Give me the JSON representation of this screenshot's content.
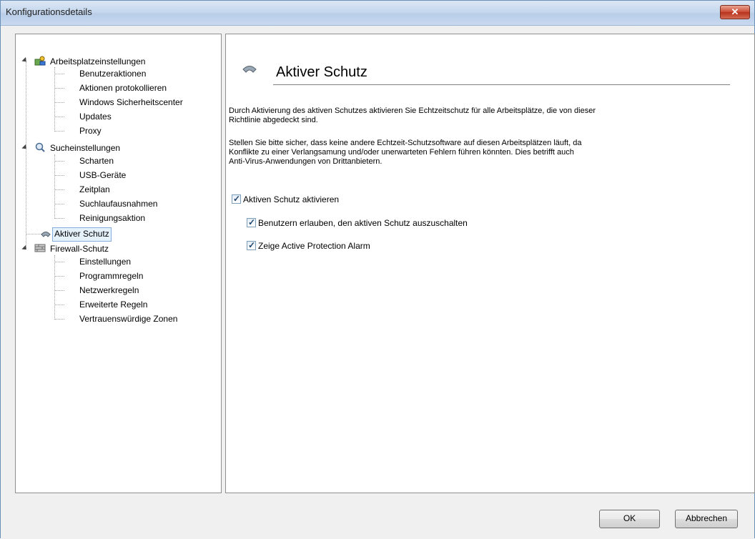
{
  "window": {
    "title": "Konfigurationsdetails",
    "close_glyph": "✕"
  },
  "tree": {
    "groups": [
      {
        "label": "Arbeitsplatzeinstellungen",
        "icon": "workstation-settings-icon",
        "children": [
          "Benutzeraktionen",
          "Aktionen protokollieren",
          "Windows Sicherheitscenter",
          "Updates",
          "Proxy"
        ]
      },
      {
        "label": "Sucheinstellungen",
        "icon": "search-settings-icon",
        "children": [
          "Scharten",
          "USB-Geräte",
          "Zeitplan",
          "Suchlaufausnahmen",
          "Reinigungsaktion"
        ]
      },
      {
        "label": "Aktiver Schutz",
        "icon": "active-protection-icon",
        "children": []
      },
      {
        "label": "Firewall-Schutz",
        "icon": "firewall-icon",
        "children": [
          "Einstellungen",
          "Programmregeln",
          "Netzwerkregeln",
          "Erweiterte Regeln",
          "Vertrauenswürdige Zonen"
        ]
      }
    ],
    "selected": "Aktiver Schutz"
  },
  "content": {
    "heading": "Aktiver Schutz",
    "para1_line1": "Durch Aktivierung des aktiven Schutzes aktivieren Sie Echtzeitschutz für alle Arbeitsplätze, die von dieser",
    "para1_line2": "Richtlinie abgedeckt sind.",
    "para2_line1": "Stellen Sie bitte sicher, dass keine andere Echtzeit-Schutzsoftware auf diesen Arbeitsplätzen läuft, da",
    "para2_line2": "Konflikte zu einer Verlangsamung und/oder unerwarteten Fehlern führen könnten. Dies betrifft auch",
    "para2_line3": "Anti-Virus-Anwendungen von Drittanbietern.",
    "checkboxes": {
      "enable": {
        "label": "Aktiven Schutz aktivieren",
        "checked": true
      },
      "allow_users": {
        "label": "Benutzern erlauben, den aktiven Schutz auszuschalten",
        "checked": true
      },
      "show_alarm": {
        "label": "Zeige Active Protection Alarm",
        "checked": true
      }
    }
  },
  "buttons": {
    "ok": "OK",
    "cancel": "Abbrechen"
  }
}
